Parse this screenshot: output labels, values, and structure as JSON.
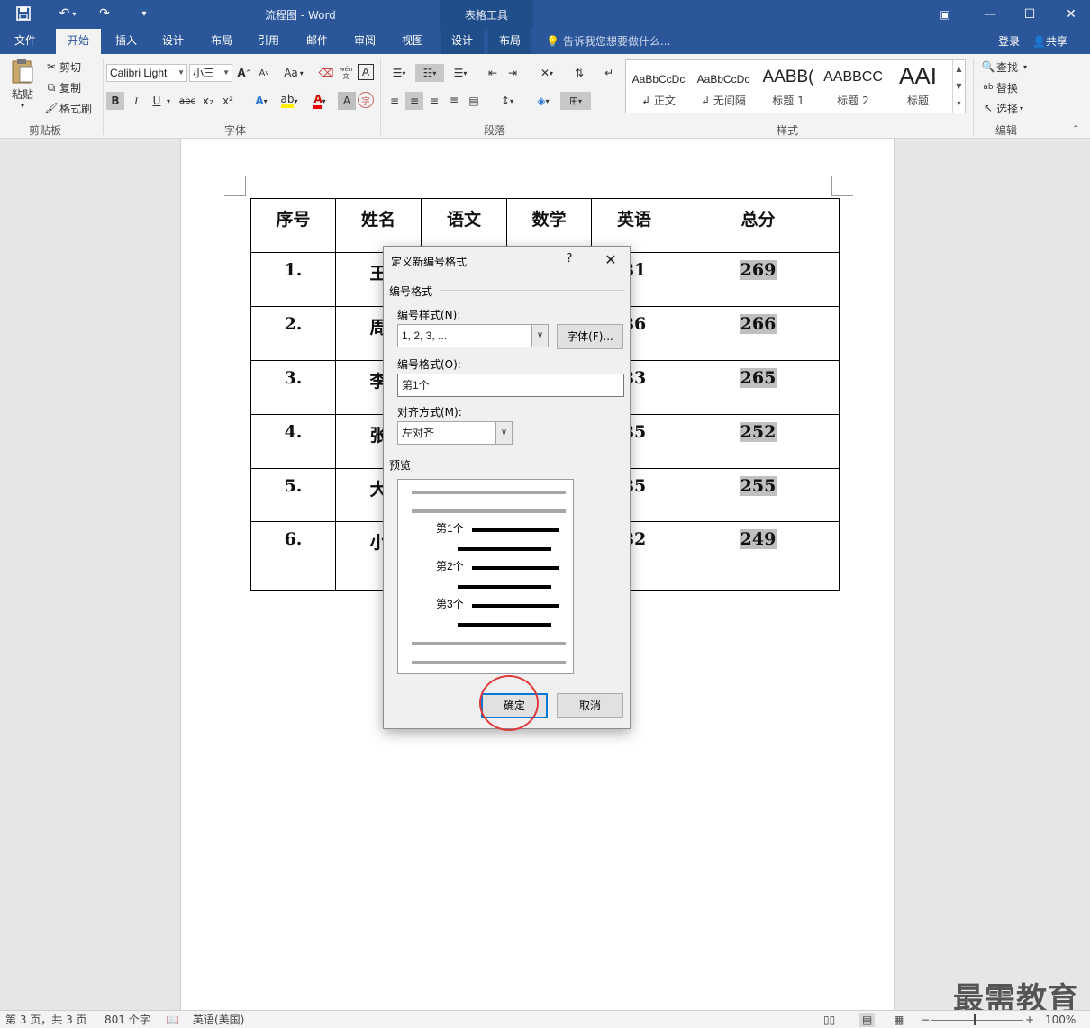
{
  "app": {
    "doc_title": "流程图 - Word",
    "context_tools_label": "表格工具",
    "tell_me": "告诉我您想要做什么...",
    "login": "登录",
    "share": "共享"
  },
  "tabs": [
    {
      "label": "文件"
    },
    {
      "label": "开始"
    },
    {
      "label": "插入"
    },
    {
      "label": "设计"
    },
    {
      "label": "布局"
    },
    {
      "label": "引用"
    },
    {
      "label": "邮件"
    },
    {
      "label": "审阅"
    },
    {
      "label": "视图"
    },
    {
      "label": "设计"
    },
    {
      "label": "布局"
    }
  ],
  "ribbon": {
    "clipboard": {
      "paste": "粘贴",
      "cut": "剪切",
      "copy": "复制",
      "format_painter": "格式刷",
      "label": "剪贴板"
    },
    "font": {
      "name": "Calibri Light",
      "size": "小三",
      "label": "字体",
      "aa": "Aa",
      "bold": "B",
      "italic": "I",
      "underline": "U",
      "strike": "abc",
      "sub": "x₂",
      "sup": "x²",
      "grow": "A",
      "shrink": "A",
      "wen": "wén",
      "wen_char": "文"
    },
    "paragraph": {
      "label": "段落"
    },
    "styles": {
      "label": "样式",
      "items": [
        {
          "sample": "AaBbCcDc",
          "name": "↲ 正文"
        },
        {
          "sample": "AaBbCcDc",
          "name": "↲ 无间隔"
        },
        {
          "sample": "AABB(",
          "name": "标题 1"
        },
        {
          "sample": "AABBCC",
          "name": "标题 2"
        },
        {
          "sample": "AAI",
          "name": "标题"
        }
      ]
    },
    "editing": {
      "find": "查找",
      "replace": "替换",
      "select": "选择",
      "label": "编辑"
    }
  },
  "table": {
    "headers": [
      "序号",
      "姓名",
      "语文",
      "数学",
      "英语",
      "总分"
    ],
    "rows": [
      [
        "1.",
        "王",
        "",
        "",
        "81",
        "269"
      ],
      [
        "2.",
        "周",
        "",
        "",
        "86",
        "266"
      ],
      [
        "3.",
        "李",
        "",
        "",
        "83",
        "265"
      ],
      [
        "4.",
        "张",
        "",
        "",
        "85",
        "252"
      ],
      [
        "5.",
        "大",
        "",
        "",
        "85",
        "255"
      ],
      [
        "6.",
        "小",
        "",
        "",
        "82",
        "249"
      ]
    ]
  },
  "dialog": {
    "title": "定义新编号格式",
    "help": "?",
    "close": "✕",
    "section_format": "编号格式",
    "style_label": "编号样式(N):",
    "style_value": "1, 2, 3, ...",
    "font_button": "字体(F)...",
    "format_label": "编号格式(O):",
    "format_value": "第1个",
    "align_label": "对齐方式(M):",
    "align_value": "左对齐",
    "section_preview": "预览",
    "preview_items": [
      "第1个",
      "第2个",
      "第3个"
    ],
    "ok": "确定",
    "cancel": "取消"
  },
  "status": {
    "page": "第 3 页，共 3 页",
    "words": "801 个字",
    "language": "英语(美国)",
    "zoom": "100%"
  },
  "watermark": "最需教育",
  "colors": {
    "title_bar": "#2b579a",
    "ok_border": "#0078d7",
    "annotation": "#e03a3a"
  }
}
